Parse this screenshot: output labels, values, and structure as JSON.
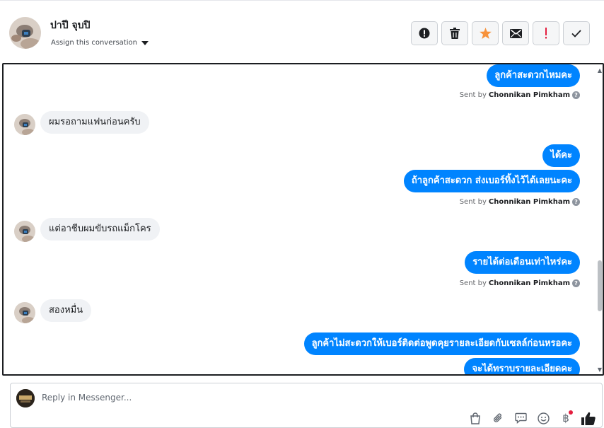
{
  "header": {
    "contact_name": "ปาปี จุบปิ",
    "assign_label": "Assign this conversation"
  },
  "actions": [
    {
      "name": "spam-button",
      "icon": "alert-circle-icon"
    },
    {
      "name": "delete-button",
      "icon": "trash-icon"
    },
    {
      "name": "star-button",
      "icon": "star-icon",
      "color": "#f7923b"
    },
    {
      "name": "mark-unread-button",
      "icon": "envelope-icon"
    },
    {
      "name": "follow-up-button",
      "icon": "exclamation-icon",
      "color": "#e41e3f"
    },
    {
      "name": "mark-done-button",
      "icon": "checkmark-icon"
    }
  ],
  "messages": {
    "m1": "ลูกค้าสะดวกไหมคะ",
    "m2": "ผมรอถามแฟนก่อนครับ",
    "m3": "ได้คะ",
    "m4": "ถ้าลูกค้าสะดวก ส่งเบอร์ทิ้งไว้ได้เลยนะคะ",
    "m5": "แต่อาชีบผมขับรถแม็กโคร",
    "m6": "รายได้ต่อเดือนเท่าไหร่คะ",
    "m7": "สองหมื่น",
    "m8": "ลูกค้าไม่สะดวกให้เบอร์ติดต่อพูดคุยรายละเอียดกับเซลล์ก่อนหรอคะ",
    "m9": "จะได้ทราบรายละเอียดคะ"
  },
  "sent_by": {
    "prefix": "Sent by",
    "name": "Chonnikan Pimkham",
    "help": "?"
  },
  "reply": {
    "placeholder": "Reply in Messenger..."
  },
  "tools": {
    "currency_symbol": "฿"
  },
  "colors": {
    "outgoing_bubble": "#0084ff",
    "incoming_bubble": "#f0f2f5",
    "alert_dot": "#e41e3f"
  }
}
